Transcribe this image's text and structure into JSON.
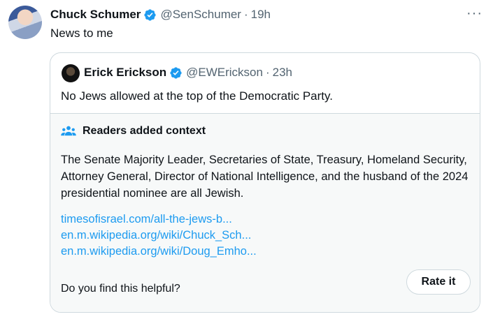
{
  "tweet": {
    "author_name": "Chuck Schumer",
    "handle": "@SenSchumer",
    "separator": "·",
    "time": "19h",
    "text": "News to me",
    "more_label": "···"
  },
  "quoted": {
    "author_name": "Erick Erickson",
    "handle": "@EWErickson",
    "separator": "·",
    "time": "23h",
    "text": "No Jews allowed at the top of the Democratic Party."
  },
  "context": {
    "title": "Readers added context",
    "body": "The Senate Majority Leader, Secretaries of State, Treasury, Homeland Security, Attorney General, Director of National Intelligence, and the husband of the 2024 presidential nominee are all Jewish.",
    "links": [
      "timesofisrael.com/all-the-jews-b...",
      "en.m.wikipedia.org/wiki/Chuck_Sch...",
      "en.m.wikipedia.org/wiki/Doug_Emho..."
    ],
    "helpful_prompt": "Do you find this helpful?",
    "rate_label": "Rate it"
  },
  "colors": {
    "link": "#1d9bf0",
    "verified": "#1d9bf0",
    "muted": "#536471",
    "border": "#cfd9de",
    "context_bg": "#f7f9f9"
  },
  "icons": [
    "verified-badge-icon",
    "more-icon",
    "people-icon"
  ]
}
